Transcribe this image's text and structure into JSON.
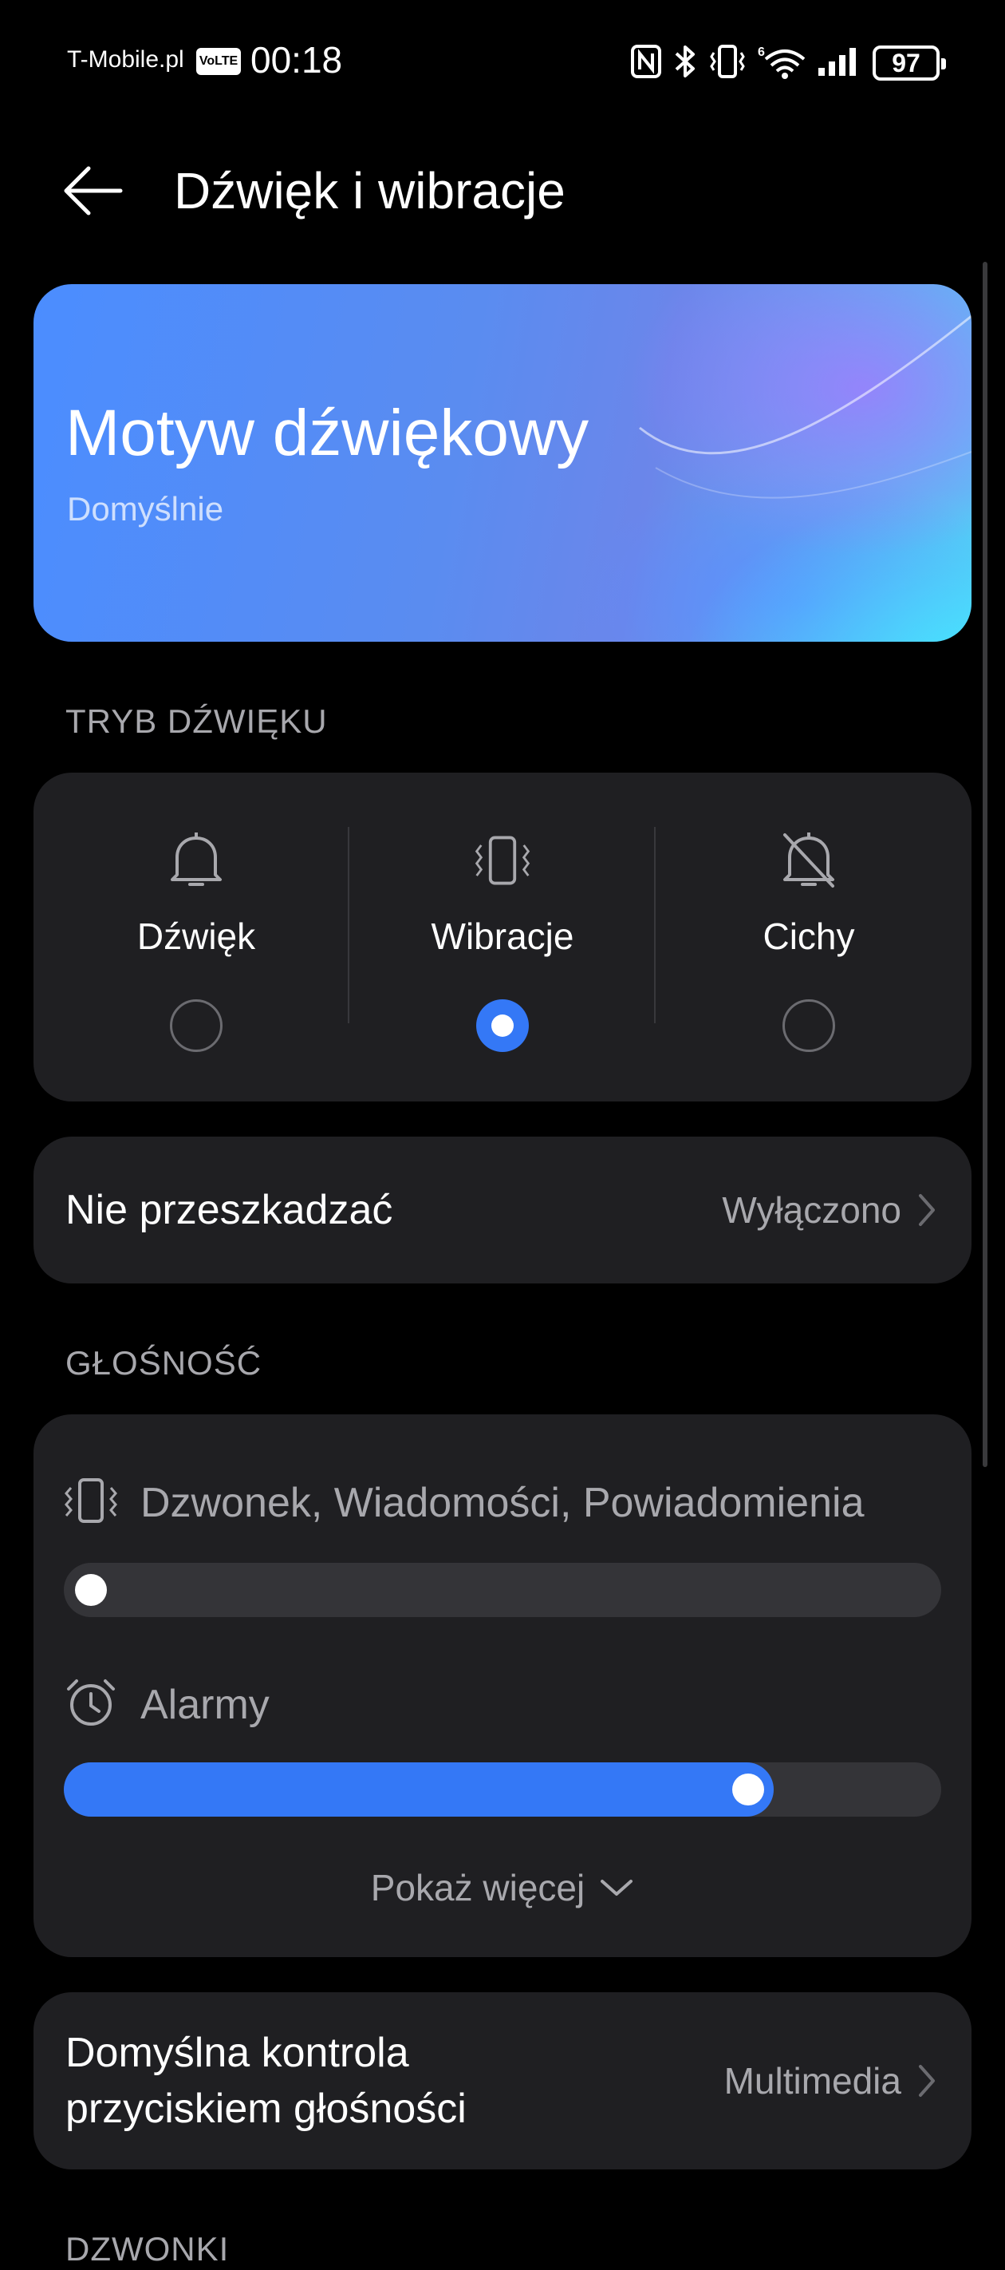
{
  "status_bar": {
    "carrier": "T-Mobile.pl",
    "volte": "VoLTE",
    "time": "00:18",
    "battery": "97",
    "icons": [
      "nfc-icon",
      "bluetooth-icon",
      "vibrate-icon",
      "wifi-6-icon",
      "signal-icon",
      "battery-icon"
    ]
  },
  "header": {
    "title": "Dźwięk i wibracje"
  },
  "banner": {
    "title": "Motyw dźwiękowy",
    "subtitle": "Domyślnie"
  },
  "sound_mode": {
    "section_label": "TRYB DŹWIĘKU",
    "options": [
      {
        "label": "Dźwięk",
        "icon": "bell-icon",
        "selected": false
      },
      {
        "label": "Wibracje",
        "icon": "vibrate-icon",
        "selected": true
      },
      {
        "label": "Cichy",
        "icon": "bell-off-icon",
        "selected": false
      }
    ]
  },
  "do_not_disturb": {
    "label": "Nie przeszkadzać",
    "value": "Wyłączono"
  },
  "volume": {
    "section_label": "GŁOŚNOŚĆ",
    "sliders": [
      {
        "label": "Dzwonek, Wiadomości, Powiadomienia",
        "icon": "vibrate-icon",
        "level": 0.0
      },
      {
        "label": "Alarmy",
        "icon": "alarm-icon",
        "level": 0.81
      }
    ],
    "show_more": "Pokaż więcej"
  },
  "volume_button_control": {
    "label_line1": "Domyślna kontrola",
    "label_line2": "przyciskiem głośności",
    "value": "Multimedia"
  },
  "ringtones": {
    "section_label": "DZWONKI"
  },
  "colors": {
    "accent": "#3478f6",
    "card_bg": "#1f1f22",
    "secondary_text": "#a8a8ad"
  }
}
